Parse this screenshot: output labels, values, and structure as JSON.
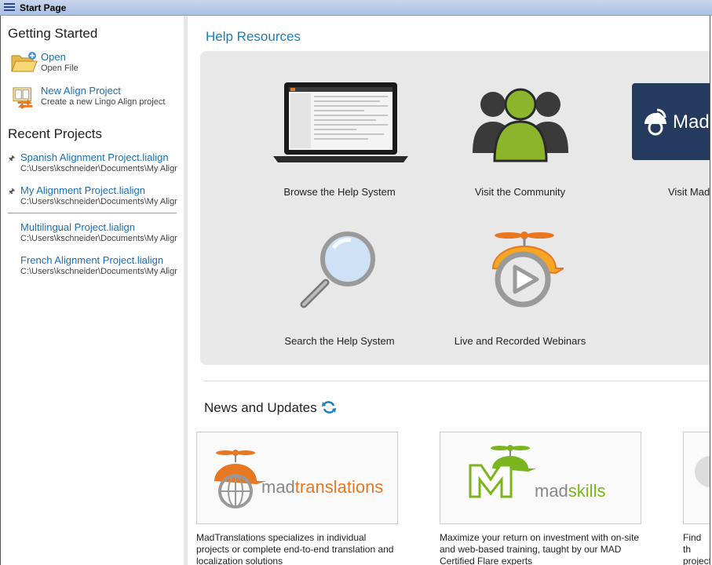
{
  "window": {
    "title": "Start Page"
  },
  "sidebar": {
    "getting_started_title": "Getting Started",
    "actions": [
      {
        "label": "Open",
        "sub": "Open File"
      },
      {
        "label": "New Align Project",
        "sub": "Create a new Lingo Align project"
      }
    ],
    "recent_title": "Recent Projects",
    "pinned": [
      {
        "name": "Spanish Alignment Project.lialign",
        "path": "C:\\Users\\kschneider\\Documents\\My Align"
      },
      {
        "name": "My Alignment Project.lialign",
        "path": "C:\\Users\\kschneider\\Documents\\My Align"
      }
    ],
    "recent": [
      {
        "name": "Multilingual Project.lialign",
        "path": "C:\\Users\\kschneider\\Documents\\My Align"
      },
      {
        "name": "French Alignment Project.lialign",
        "path": "C:\\Users\\kschneider\\Documents\\My Align"
      }
    ]
  },
  "help": {
    "title": "Help Resources",
    "tiles": [
      {
        "label": "Browse the Help System",
        "icon": "laptop-icon"
      },
      {
        "label": "Visit the Community",
        "icon": "community-icon"
      },
      {
        "label": "Visit Mad",
        "icon": "madcap-icon",
        "logo_text": "Mad"
      },
      {
        "label": "Search the Help System",
        "icon": "magnifier-icon"
      },
      {
        "label": "Live and Recorded Webinars",
        "icon": "webinar-icon"
      }
    ]
  },
  "news": {
    "title": "News and Updates",
    "cards": [
      {
        "logo_a": "mad",
        "logo_b": "translations",
        "text": "MadTranslations specializes in individual projects or complete end-to-end translation and localization solutions"
      },
      {
        "logo_a": "mad",
        "logo_b": "skills",
        "text": "Maximize your return on investment with on-site and web-based training, taught by our MAD Certified Flare experts"
      },
      {
        "text": "Find th project MAD"
      }
    ]
  },
  "colors": {
    "link": "#1a6fb5",
    "accent": "#1a7fbf",
    "panel": "#e8e8e8",
    "orange": "#e87722",
    "green": "#7ab51d"
  }
}
